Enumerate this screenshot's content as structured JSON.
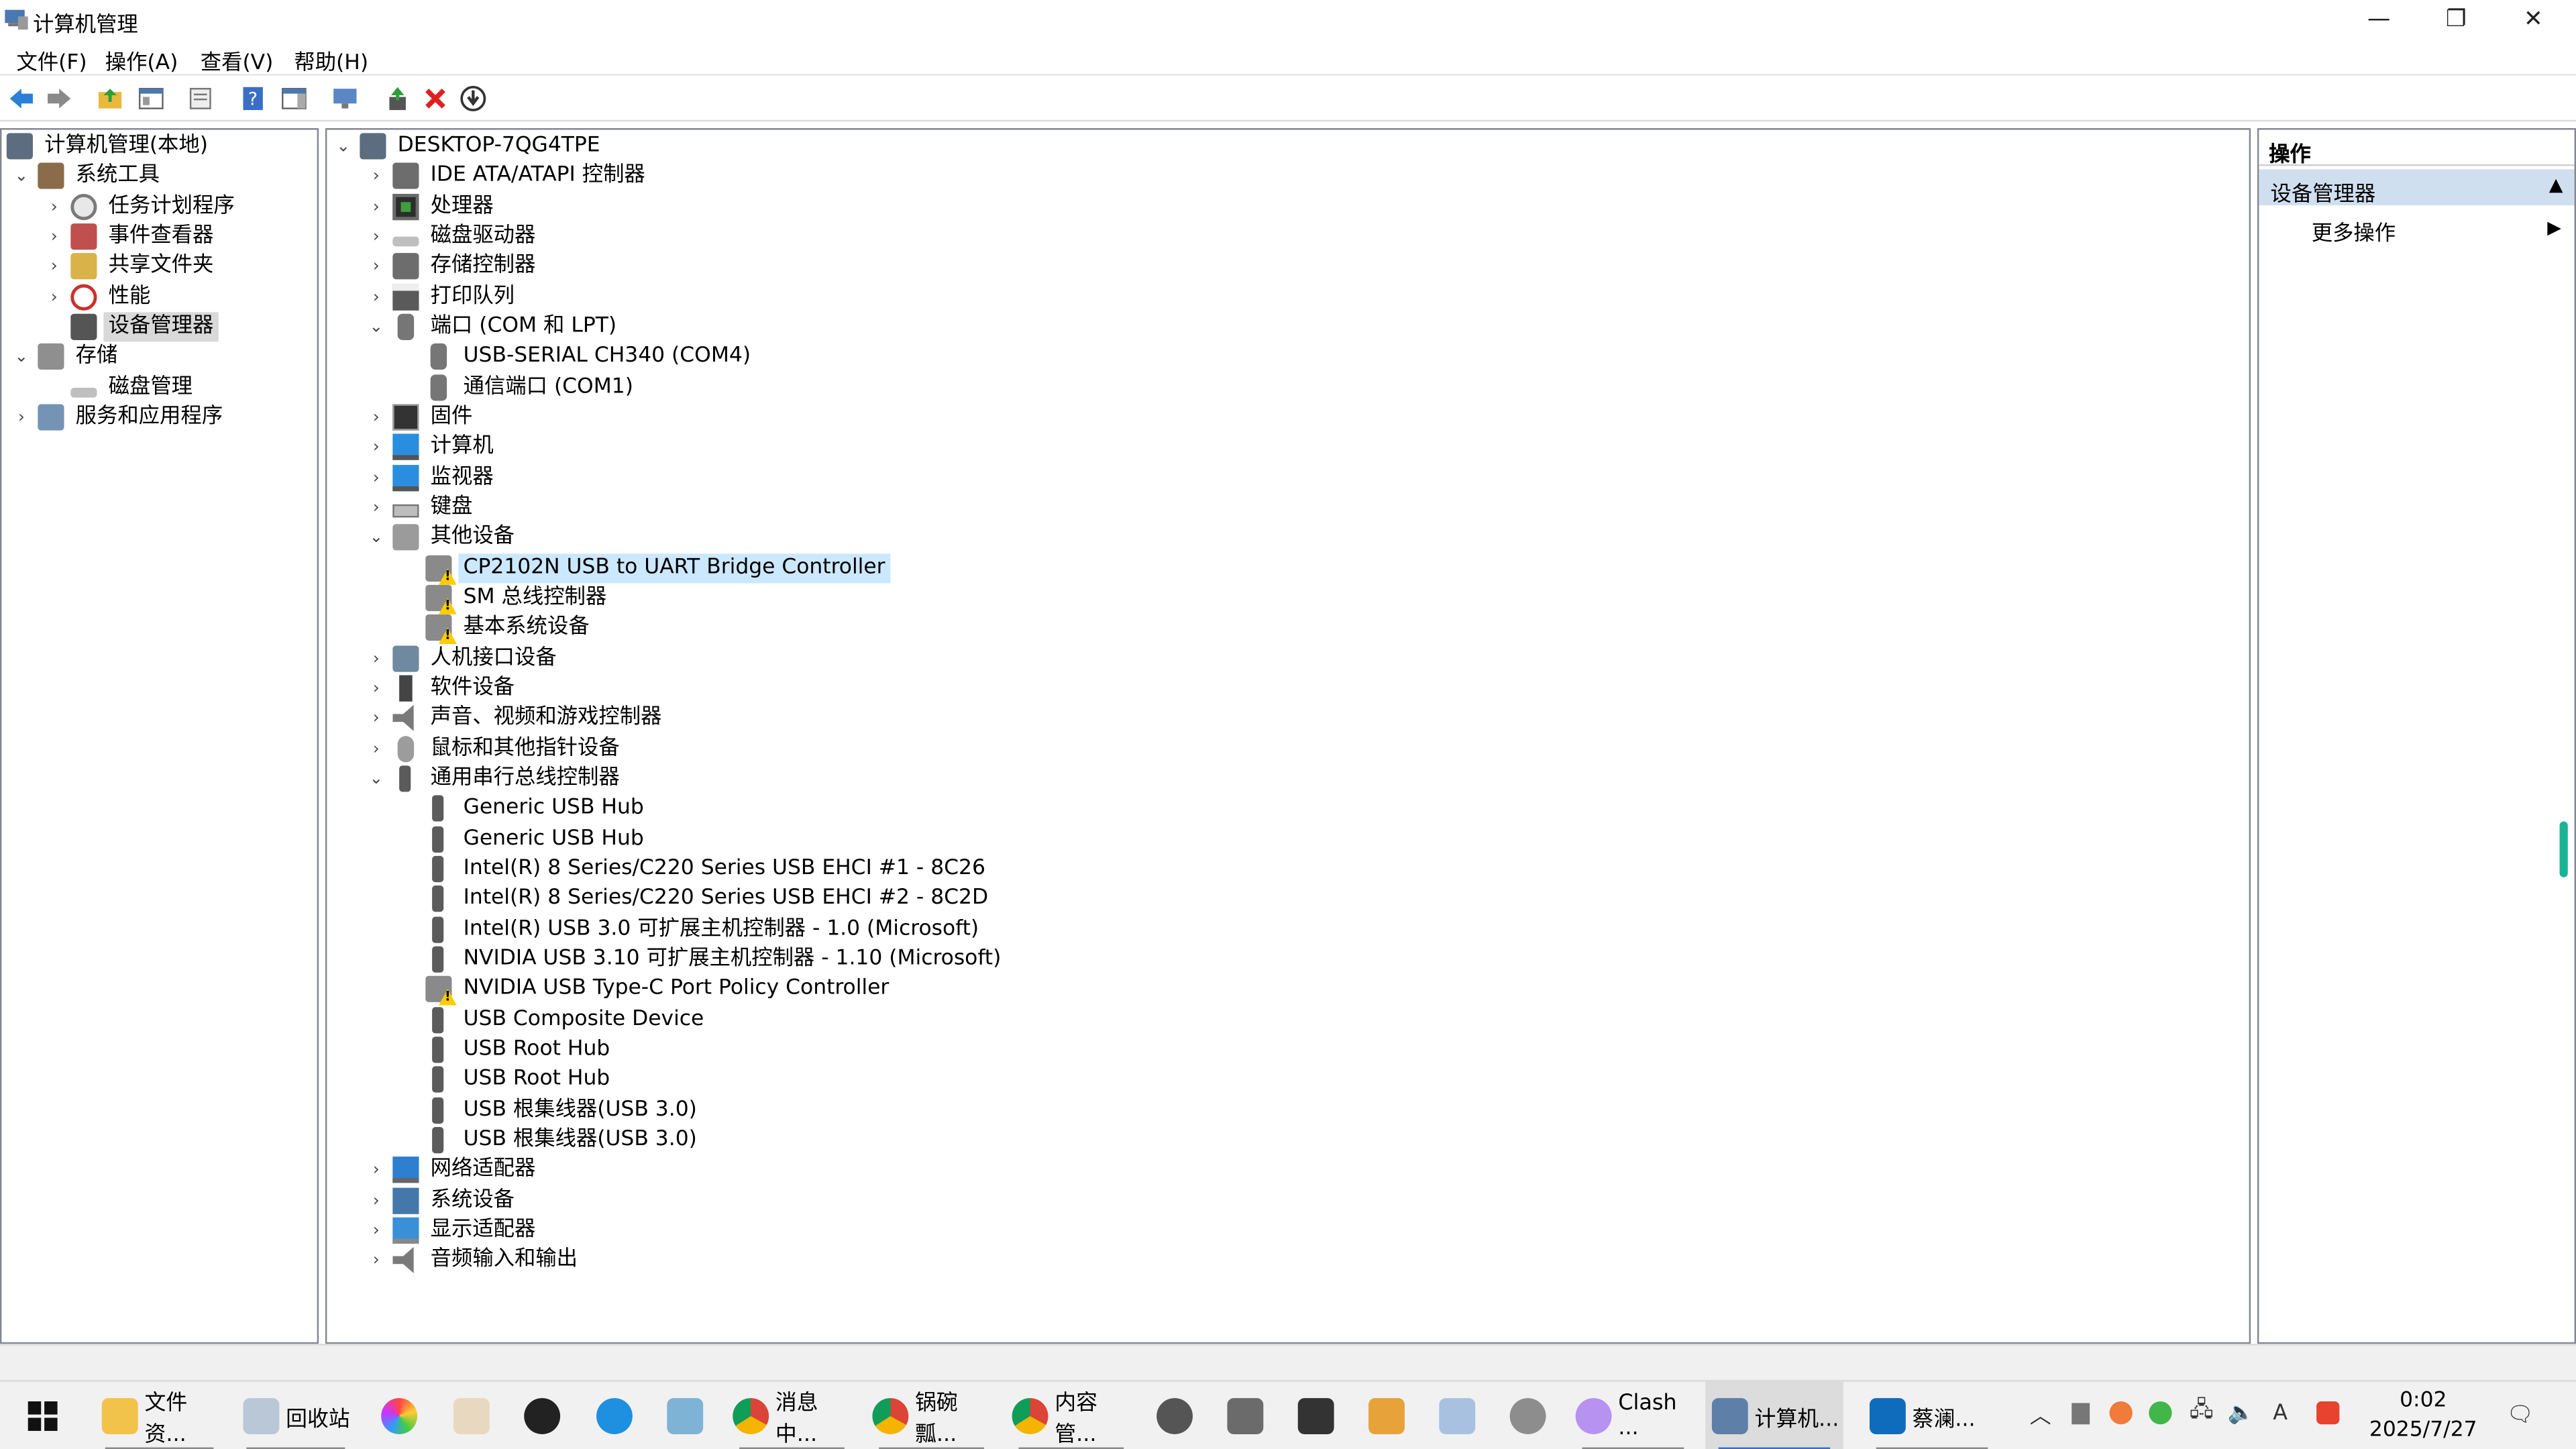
{
  "window": {
    "title": "计算机管理",
    "minimize_icon": "minimize-icon",
    "restore_icon": "restore-icon",
    "close_icon": "close-icon"
  },
  "menu": [
    "文件(F)",
    "操作(A)",
    "查看(V)",
    "帮助(H)"
  ],
  "toolbar": {
    "icons": [
      "back-arrow-icon",
      "forward-arrow-icon",
      "up-folder-icon",
      "show-hide-console-tree-icon",
      "properties-icon",
      "help-icon",
      "show-hide-action-pane-icon",
      "monitor-icon",
      "update-driver-icon",
      "uninstall-device-icon",
      "download-icon"
    ]
  },
  "left_tree": {
    "root": "计算机管理(本地)",
    "system_tools": "系统工具",
    "task_scheduler": "任务计划程序",
    "event_viewer": "事件查看器",
    "shared_folders": "共享文件夹",
    "performance": "性能",
    "device_manager": "设备管理器",
    "storage": "存储",
    "disk_management": "磁盘管理",
    "services_apps": "服务和应用程序"
  },
  "device_tree": {
    "computer_name": "DESKTOP-7QG4TPE",
    "categories": {
      "ide": "IDE ATA/ATAPI 控制器",
      "cpu": "处理器",
      "disk": "磁盘驱动器",
      "storage": "存储控制器",
      "print": "打印队列",
      "ports": "端口 (COM 和 LPT)",
      "firmware": "固件",
      "computer": "计算机",
      "monitors": "监视器",
      "keyboard": "键盘",
      "other": "其他设备",
      "hid": "人机接口设备",
      "software": "软件设备",
      "sound": "声音、视频和游戏控制器",
      "mouse": "鼠标和其他指针设备",
      "usb": "通用串行总线控制器",
      "network": "网络适配器",
      "system": "系统设备",
      "display": "显示适配器",
      "audio_io": "音频输入和输出"
    },
    "ports_children": [
      "USB-SERIAL CH340 (COM4)",
      "通信端口 (COM1)"
    ],
    "other_children": [
      "CP2102N USB to UART Bridge Controller",
      "SM 总线控制器",
      "基本系统设备"
    ],
    "usb_children": [
      "Generic USB Hub",
      "Generic USB Hub",
      "Intel(R) 8 Series/C220 Series USB EHCI #1 - 8C26",
      "Intel(R) 8 Series/C220 Series USB EHCI #2 - 8C2D",
      "Intel(R) USB 3.0 可扩展主机控制器 - 1.0 (Microsoft)",
      "NVIDIA USB 3.10 可扩展主机控制器 - 1.10 (Microsoft)",
      "NVIDIA USB Type-C Port Policy Controller",
      "USB Composite Device",
      "USB Root Hub",
      "USB Root Hub",
      "USB 根集线器(USB 3.0)",
      "USB 根集线器(USB 3.0)"
    ]
  },
  "actions": {
    "header": "操作",
    "section": "设备管理器",
    "more": "更多操作"
  },
  "taskbar": {
    "file_explorer": "文件资...",
    "recycle_bin": "回收站",
    "chrome1": "消息中...",
    "chrome2": "锅碗瓢...",
    "chrome3": "内容管...",
    "clash": "Clash ...",
    "computer_mgmt": "计算机...",
    "outlook": "蔡澜...",
    "time": "0:02",
    "date": "2025/7/27"
  }
}
